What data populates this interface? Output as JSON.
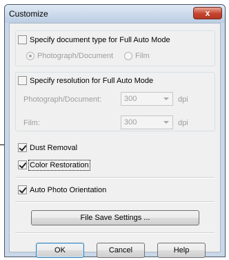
{
  "window": {
    "title": "Customize",
    "close_label": "x"
  },
  "document_type": {
    "checkbox_label": "Specify document type for Full Auto Mode",
    "checked": false,
    "options": [
      {
        "label": "Photograph/Document",
        "selected": true
      },
      {
        "label": "Film",
        "selected": false
      }
    ]
  },
  "resolution": {
    "checkbox_label": "Specify resolution for Full Auto Mode",
    "checked": false,
    "photo_label": "Photograph/Document:",
    "photo_value": "300",
    "film_label": "Film:",
    "film_value": "300",
    "unit": "dpi"
  },
  "options": {
    "dust_removal": {
      "label": "Dust Removal",
      "checked": true
    },
    "color_restoration": {
      "label": "Color Restoration",
      "checked": true
    },
    "auto_photo_orientation": {
      "label": "Auto Photo Orientation",
      "checked": true
    }
  },
  "buttons": {
    "file_save": "File Save Settings ...",
    "ok": "OK",
    "cancel": "Cancel",
    "help": "Help"
  },
  "colors": {
    "titlebar": "#c9d7e8",
    "close": "#c4442e",
    "client": "#f0f0f0"
  }
}
